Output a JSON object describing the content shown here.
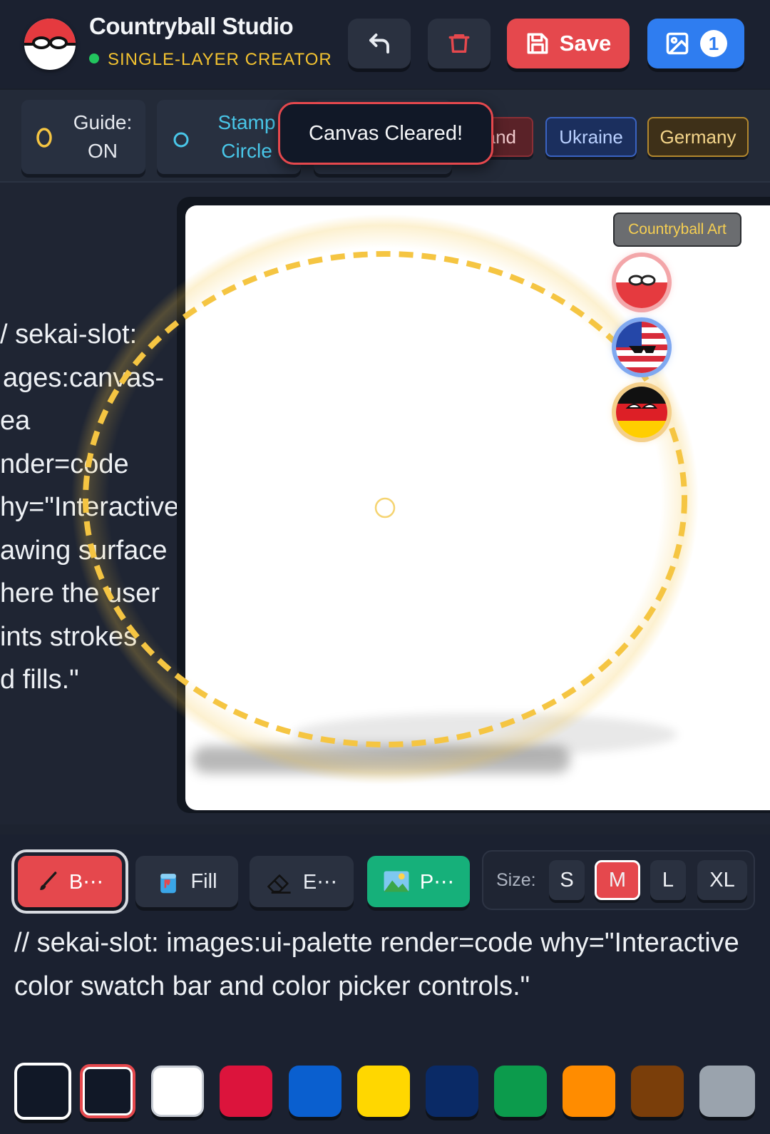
{
  "header": {
    "title": "Countryball Studio",
    "subtitle": "SINGLE-LAYER CREATOR",
    "save_label": "Save",
    "gallery_count": "1"
  },
  "chips": {
    "guide": {
      "line1": "Guide:",
      "line2": "ON"
    },
    "stamp": {
      "line1": "Stamp",
      "line2": "Circle"
    },
    "countries": [
      "and",
      "Ukraine",
      "Germany"
    ]
  },
  "toast": "Canvas Cleared!",
  "canvas": {
    "slot_note_lines": [
      "/ sekai-slot:",
      "ages:canvas-",
      "ea",
      "nder=code",
      "hy=\"Interactive",
      "awing surface",
      "here the user",
      "ints strokes",
      "d fills.\""
    ],
    "art_tag": "Countryball Art",
    "stamps": [
      "poland-ball",
      "usa-ball",
      "germany-ball"
    ]
  },
  "tools": {
    "brush": "B⋯",
    "fill": "Fill",
    "eraser": "E⋯",
    "photo": "P⋯"
  },
  "size": {
    "label": "Size:",
    "options": [
      "S",
      "M",
      "L",
      "XL"
    ],
    "selected": "M"
  },
  "palette": {
    "note": "// sekai-slot: images:ui-palette render=code why=\"Interactive color swatch bar and color picker controls.\"",
    "swatches": [
      "#111827",
      "#111827",
      "#ffffff",
      "#dc143c",
      "#0a5fcf",
      "#ffd700",
      "#0a2a66",
      "#0c9b4c",
      "#ff8c00",
      "#7a3e0a",
      "#9aa3ad"
    ],
    "selected_index": 1
  },
  "colors": {
    "accent_red": "#e5484d",
    "accent_blue": "#2f7df0",
    "accent_green": "#16b07a",
    "guide_yellow": "#f5c542"
  }
}
